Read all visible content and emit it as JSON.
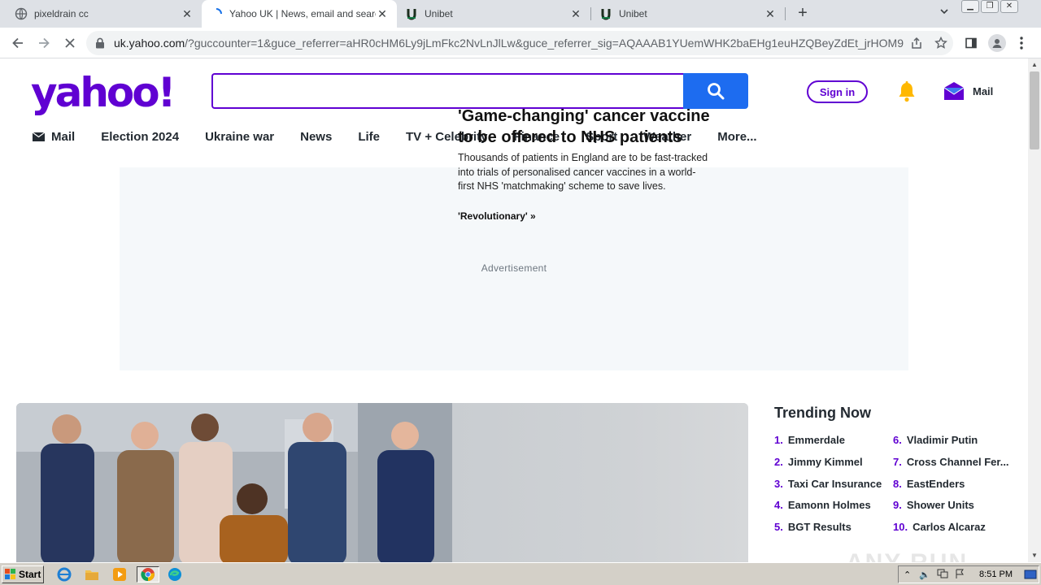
{
  "browser": {
    "tabs": [
      {
        "title": "pixeldrain cc",
        "icon": "globe-icon"
      },
      {
        "title": "Yahoo UK | News, email and search",
        "icon": "loading-spinner-icon"
      },
      {
        "title": "Unibet",
        "icon": "unibet-icon"
      },
      {
        "title": "Unibet",
        "icon": "unibet-icon"
      }
    ],
    "url_host": "uk.yahoo.com",
    "url_rest": "/?guccounter=1&guce_referrer=aHR0cHM6Ly9jLmFkc2NvLnJlLw&guce_referrer_sig=AQAAAB1YUemWHK2baEHg1euHZQBeyZdEt_jrHOM9..."
  },
  "header": {
    "logo": "yahoo!",
    "search_placeholder": "",
    "signin_label": "Sign in",
    "mail_label": "Mail"
  },
  "nav": [
    "Mail",
    "Election 2024",
    "Ukraine war",
    "News",
    "Life",
    "TV + Celebrity",
    "Finance",
    "Sport",
    "Weather",
    "More..."
  ],
  "ad_label": "Advertisement",
  "hero": {
    "title": "'Game-changing' cancer vaccine to be offered to NHS patients",
    "description": "Thousands of patients in England are to be fast-tracked into trials of personalised cancer vaccines in a world-first NHS 'matchmaking' scheme to save lives.",
    "more": "'Revolutionary' »"
  },
  "trending": {
    "title": "Trending Now",
    "items": [
      {
        "num": "1.",
        "label": "Emmerdale"
      },
      {
        "num": "2.",
        "label": "Jimmy Kimmel"
      },
      {
        "num": "3.",
        "label": "Taxi Car Insurance"
      },
      {
        "num": "4.",
        "label": "Eamonn Holmes"
      },
      {
        "num": "5.",
        "label": "BGT Results"
      },
      {
        "num": "6.",
        "label": "Vladimir Putin"
      },
      {
        "num": "7.",
        "label": "Cross Channel Fer..."
      },
      {
        "num": "8.",
        "label": "EastEnders"
      },
      {
        "num": "9.",
        "label": "Shower Units"
      },
      {
        "num": "10.",
        "label": "Carlos Alcaraz"
      }
    ]
  },
  "watermark": "ANY RUN",
  "taskbar": {
    "start_label": "Start",
    "clock": "8:51 PM"
  },
  "colors": {
    "yahoo_purple": "#6001d2",
    "search_blue": "#1d6cf0"
  }
}
